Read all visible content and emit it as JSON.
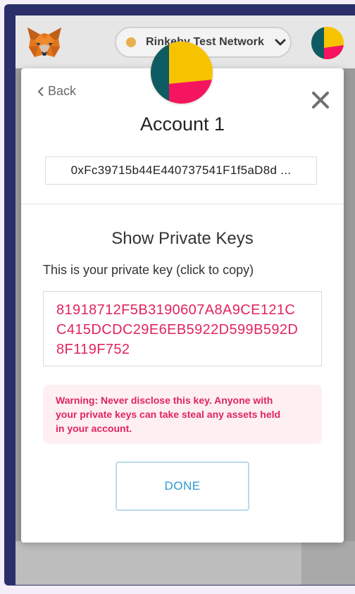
{
  "header": {
    "network_label": "Rinkeby Test Network",
    "network_dot_color": "#e9b04f",
    "logo_icon": "metamask-fox-icon",
    "avatar_icon": "identicon-avatar"
  },
  "modal": {
    "back_label": "Back",
    "close_icon": "close-icon",
    "account_name": "Account 1",
    "address": "0xFc39715b44E440737541F1f5aD8d ...",
    "section_title": "Show Private Keys",
    "hint": "This is your private key (click to copy)",
    "private_key_lines": [
      "81918712F5B3190607A8A9CE121C",
      "C415DCDC29E6EB5922D599B592D",
      "8F119F752"
    ],
    "warning_lines": [
      "Warning: Never disclose this key. Anyone with",
      "your private keys can take steal any assets held",
      "in your account."
    ],
    "done_label": "DONE"
  },
  "colors": {
    "accent_pink": "#e1245c",
    "done_blue": "#2f9ad0",
    "frame_navy": "#2a2f6b"
  }
}
